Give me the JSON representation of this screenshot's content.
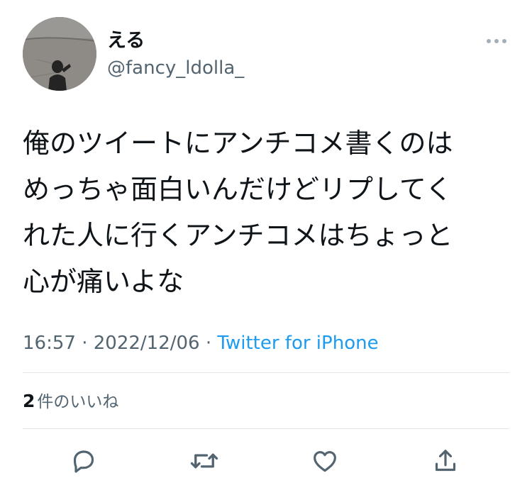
{
  "user": {
    "display_name": "える",
    "handle": "@fancy_ldolla_",
    "avatar_icon": "profile-photo-shadow-on-road"
  },
  "tweet": {
    "lines": [
      "俺のツイートにアンチコメ書くのは",
      "めっちゃ面白いんだけどリプしてく",
      "れた人に行くアンチコメはちょっと",
      "心が痛いよな"
    ],
    "time": "16:57",
    "separator": " · ",
    "date": "2022/12/06",
    "source": "Twitter for iPhone"
  },
  "stats": {
    "likes_count": "2",
    "likes_label": "件のいいね"
  },
  "actions": {
    "reply_icon": "reply-icon",
    "retweet_icon": "retweet-icon",
    "like_icon": "heart-icon",
    "share_icon": "share-icon"
  },
  "colors": {
    "text": "#0f1419",
    "secondary": "#536471",
    "link": "#1d9bf0",
    "divider": "#e1e6ea"
  }
}
